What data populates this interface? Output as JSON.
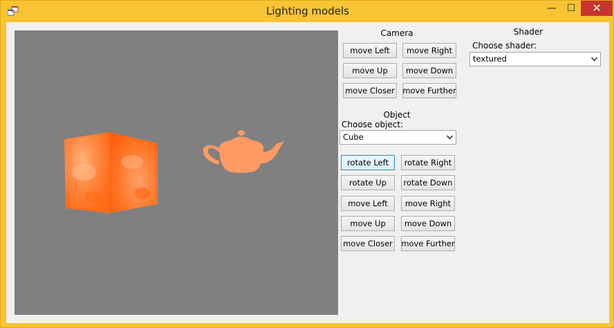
{
  "window": {
    "title": "Lighting models",
    "controls": {
      "minimize": "—",
      "maximize": "☐",
      "close": "✕"
    }
  },
  "camera": {
    "heading": "Camera",
    "buttons": [
      "move Left",
      "move Right",
      "move Up",
      "move Down",
      "move Closer",
      "move Further"
    ]
  },
  "shader": {
    "heading": "Shader",
    "label": "Choose shader:",
    "selected": "textured"
  },
  "object": {
    "heading": "Object",
    "label": "Choose object:",
    "selected": "Cube",
    "buttons": [
      "rotate Left",
      "rotate Right",
      "rotate Up",
      "rotate Down",
      "move Left",
      "move Right",
      "move Up",
      "move Down",
      "move Closer",
      "move Further"
    ]
  },
  "scene": {
    "background_color": "#808080",
    "object_color": "#ff8040",
    "objects": [
      "cube",
      "teapot"
    ]
  },
  "icons": [
    "app-icon",
    "chevron-down-icon"
  ]
}
